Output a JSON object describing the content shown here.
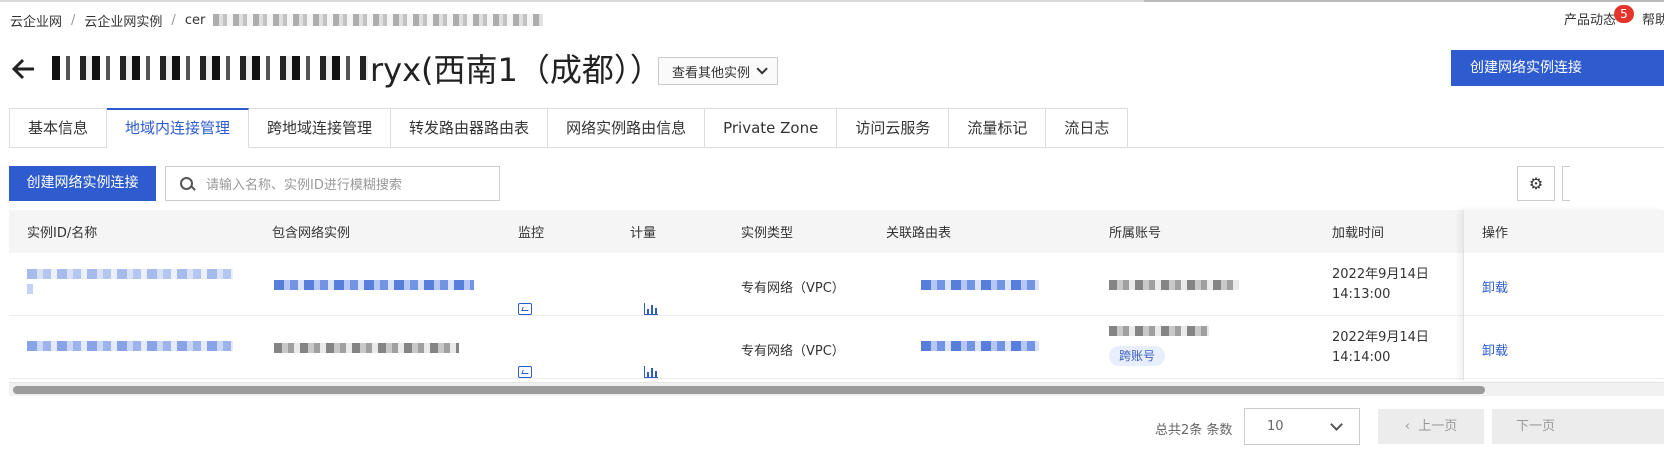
{
  "breadcrumb": {
    "items": [
      "云企业网",
      "云企业网实例",
      "cer"
    ]
  },
  "topbar": {
    "product_updates": "产品动态",
    "badge_count": "5",
    "help": "帮助"
  },
  "header": {
    "back_icon": "arrow-left-icon",
    "title_suffix": "ryx(西南1（成都））",
    "other_instances_label": "查看其他实例",
    "create_connection_top": "创建网络实例连接"
  },
  "tabs": [
    {
      "label": "基本信息",
      "active": false
    },
    {
      "label": "地域内连接管理",
      "active": true
    },
    {
      "label": "跨地域连接管理",
      "active": false
    },
    {
      "label": "转发路由器路由表",
      "active": false
    },
    {
      "label": "网络实例路由信息",
      "active": false
    },
    {
      "label": "Private Zone",
      "active": false
    },
    {
      "label": "访问云服务",
      "active": false
    },
    {
      "label": "流量标记",
      "active": false
    },
    {
      "label": "流日志",
      "active": false
    }
  ],
  "toolbar": {
    "create_label": "创建网络实例连接",
    "search_placeholder": "请输入名称、实例ID进行模糊搜索",
    "settings_icon": "gear-icon"
  },
  "table": {
    "headers": {
      "id_name": "实例ID/名称",
      "network_instance": "包含网络实例",
      "monitor": "监控",
      "metering": "计量",
      "type": "实例类型",
      "route_table": "关联路由表",
      "account": "所属账号",
      "load_time": "加载时间",
      "action": "操作"
    },
    "rows": [
      {
        "type": "专有网络（VPC）",
        "load_date": "2022年9月14日",
        "load_time": "14:13:00",
        "action": "卸载",
        "tag": ""
      },
      {
        "type": "专有网络（VPC）",
        "load_date": "2022年9月14日",
        "load_time": "14:14:00",
        "action": "卸载",
        "tag": "跨账号"
      }
    ]
  },
  "pagination": {
    "total": "总共2条 条数",
    "page_size": "10",
    "prev": "上一页",
    "next": "下一页"
  },
  "colors": {
    "primary": "#2e5cce",
    "badge": "#e5352b"
  }
}
